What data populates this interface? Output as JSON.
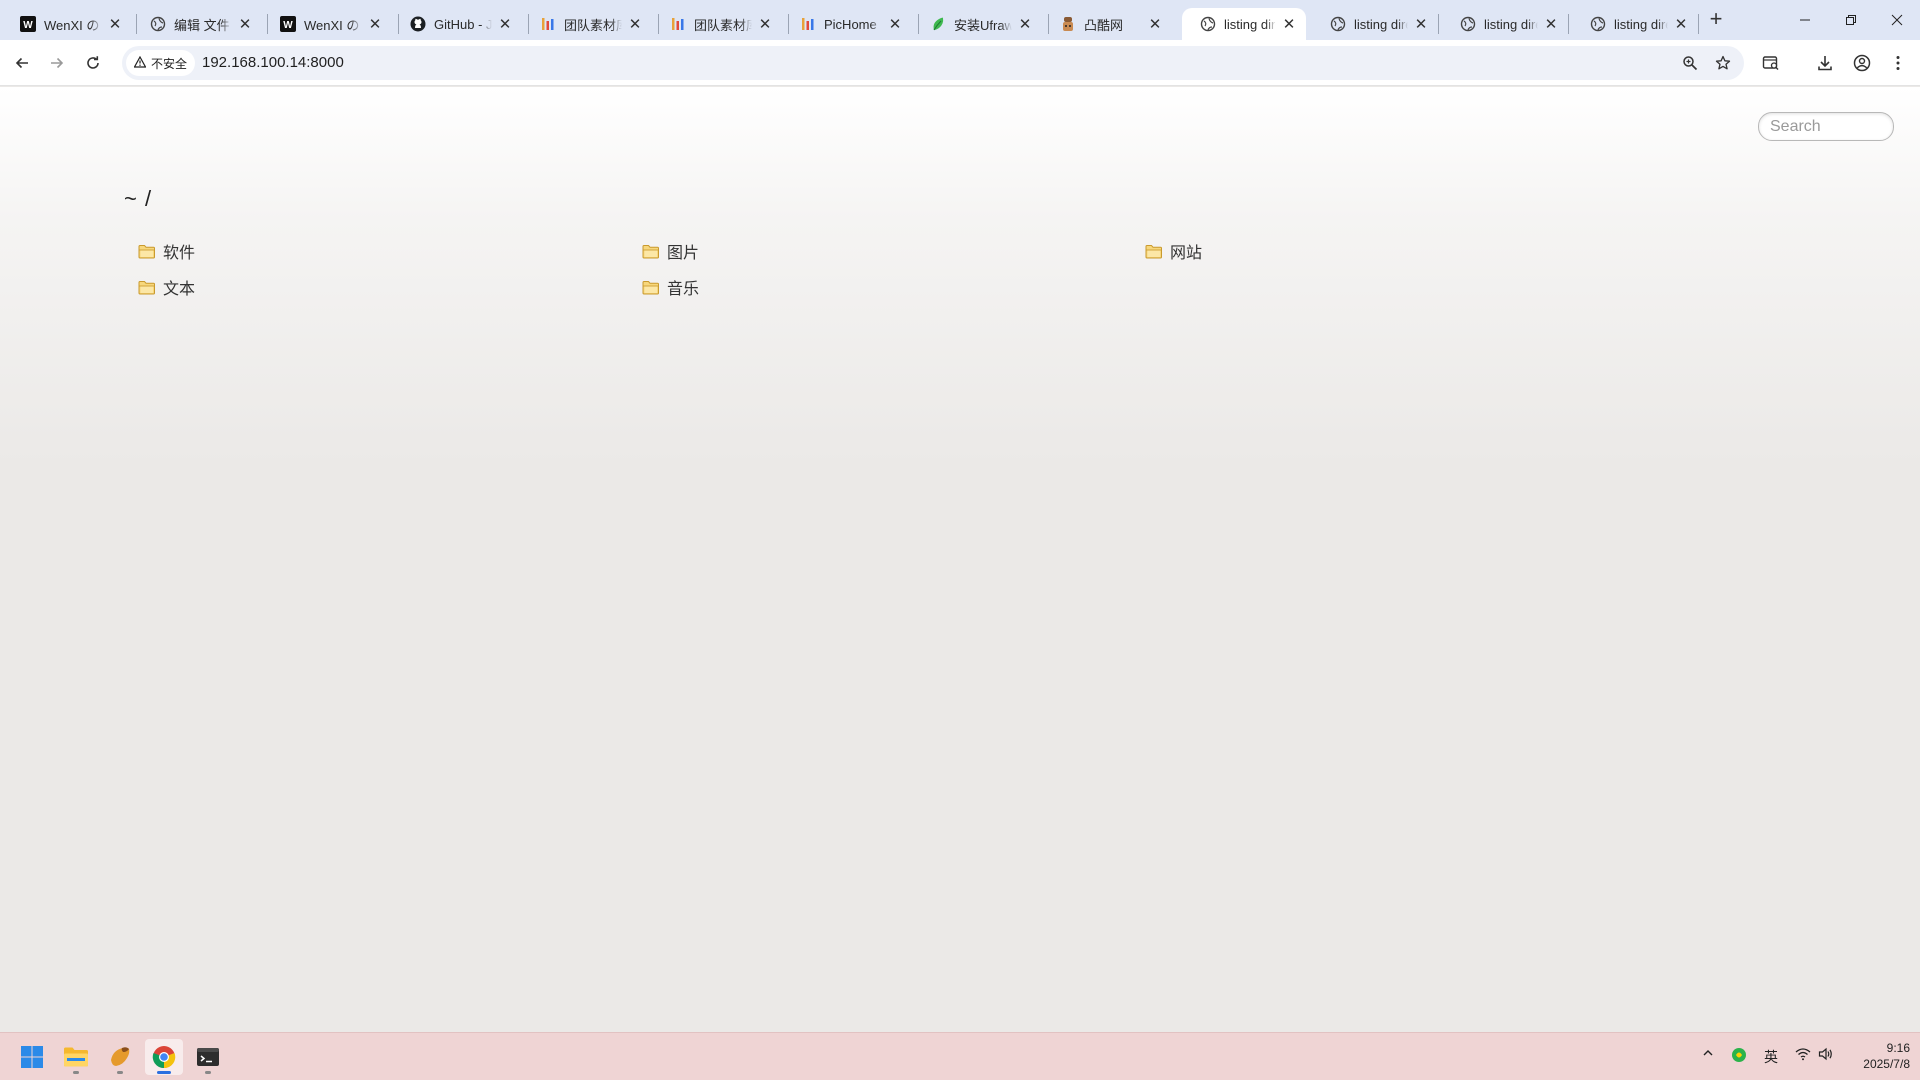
{
  "browser": {
    "tabs": [
      {
        "title": "WenXI の",
        "icon": "wenxi-icon"
      },
      {
        "title": "编辑 文件",
        "icon": "globe-icon"
      },
      {
        "title": "WenXI の",
        "icon": "wenxi-icon"
      },
      {
        "title": "GitHub - J",
        "icon": "github-icon"
      },
      {
        "title": "团队素材库",
        "icon": "bars-icon"
      },
      {
        "title": "团队素材库",
        "icon": "bars-icon"
      },
      {
        "title": "PicHome",
        "icon": "bars-icon"
      },
      {
        "title": "安装Ufraw",
        "icon": "leaf-icon"
      },
      {
        "title": "凸酷网",
        "icon": "tukuwang-icon"
      },
      {
        "title": "listing dire",
        "icon": "globe-icon",
        "active": true
      },
      {
        "title": "listing dire",
        "icon": "globe-icon"
      },
      {
        "title": "listing dire",
        "icon": "globe-icon"
      },
      {
        "title": "listing dire",
        "icon": "globe-icon"
      }
    ],
    "new_tab_label": "+",
    "security_label": "不安全",
    "url": "192.168.100.14:8000"
  },
  "page": {
    "search_placeholder": "Search",
    "breadcrumb": "~ /",
    "entries": [
      {
        "name": "软件"
      },
      {
        "name": "图片"
      },
      {
        "name": "网站"
      },
      {
        "name": "文本"
      },
      {
        "name": "音乐"
      }
    ]
  },
  "taskbar": {
    "ime_label": "英",
    "time": "9:16",
    "date": "2025/7/8"
  },
  "colors": {
    "tabstrip_bg": "#dfe6f5",
    "page_bg": "#ebe9e7",
    "taskbar_bg": "#efd4d4",
    "folder_yellow": "#f3c45a"
  }
}
